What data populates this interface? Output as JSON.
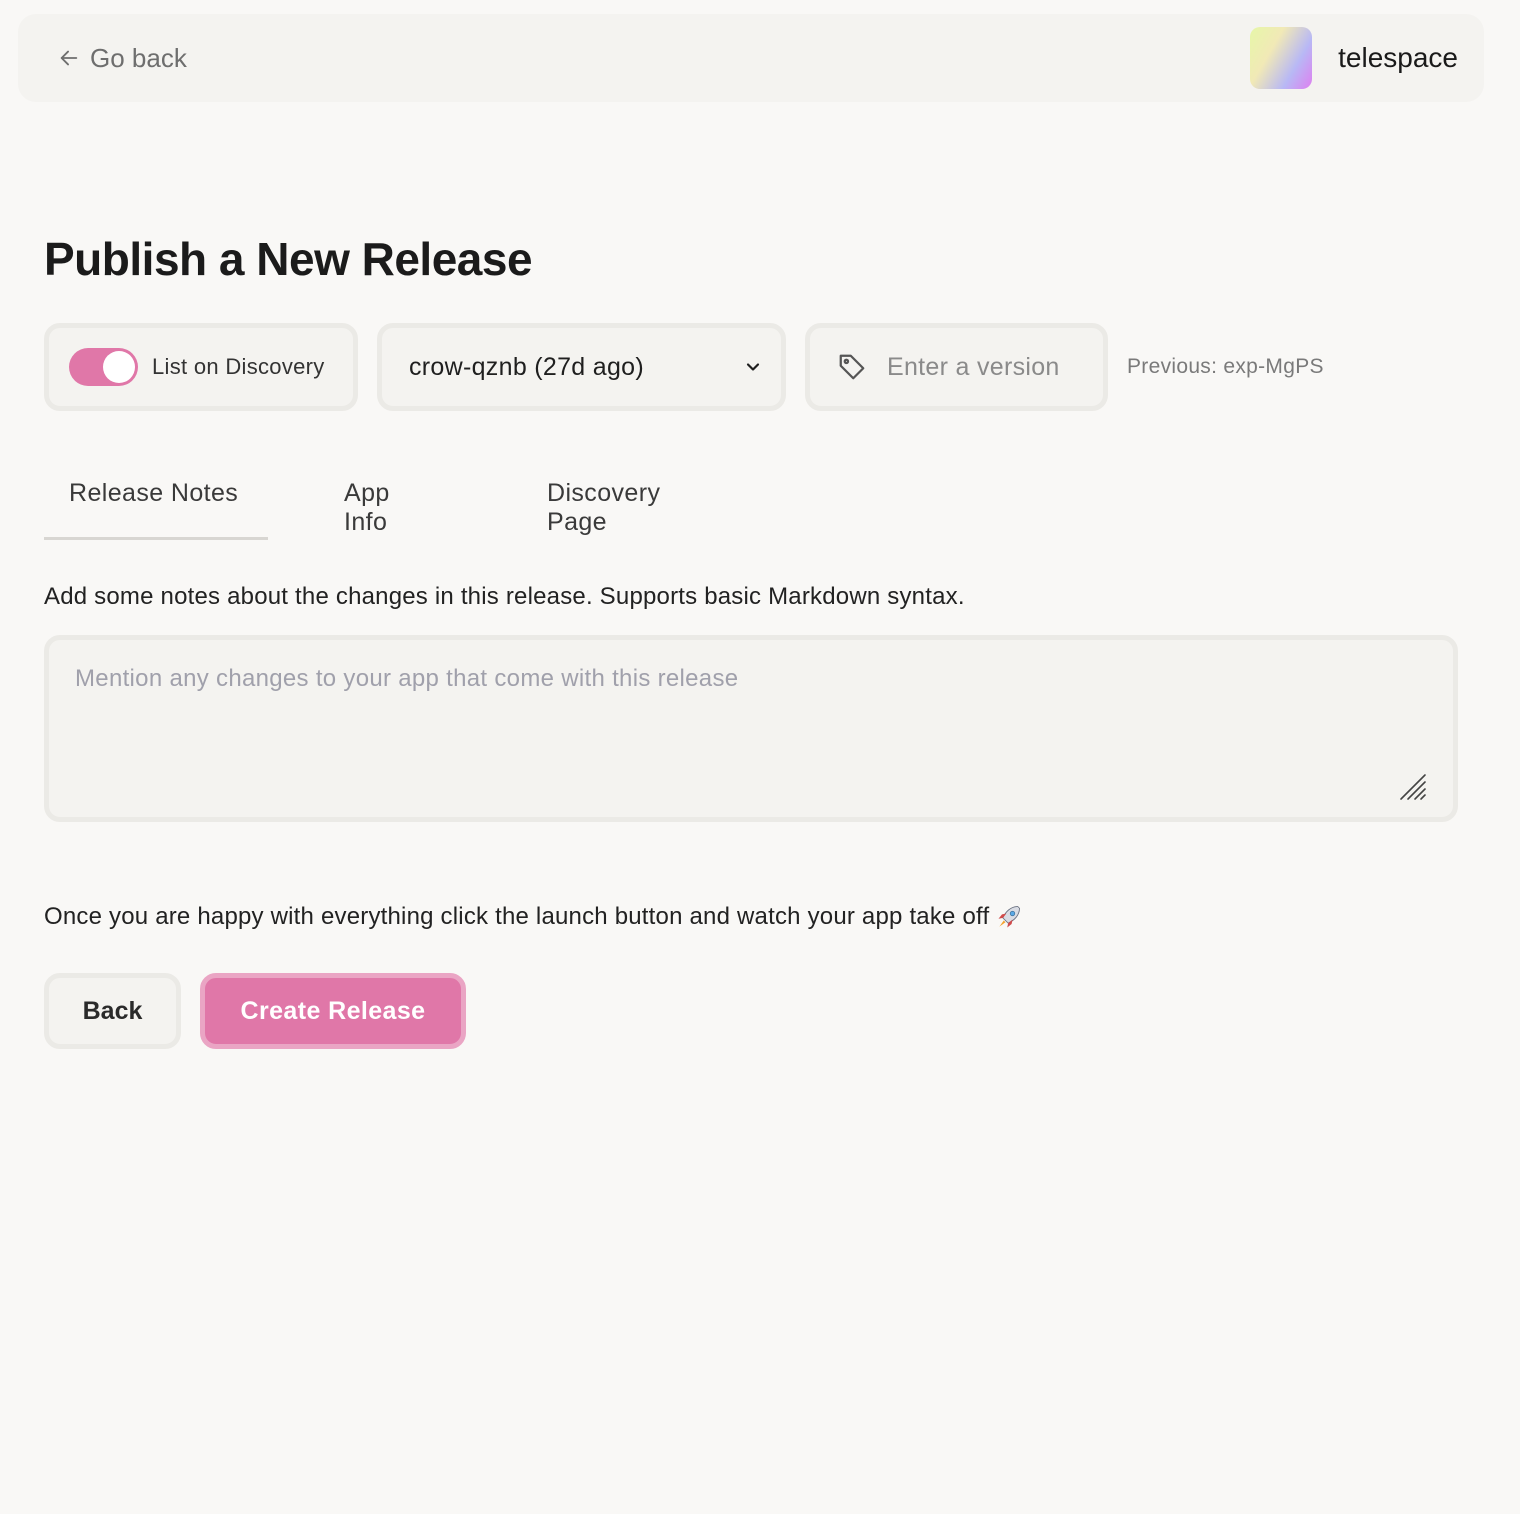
{
  "header": {
    "go_back_label": "Go back",
    "workspace_name": "telespace"
  },
  "page": {
    "title": "Publish a New Release"
  },
  "controls": {
    "list_on_discovery_label": "List on Discovery",
    "list_on_discovery_enabled": true,
    "build_select_value": "crow-qznb (27d ago)",
    "version_placeholder": "Enter a version",
    "version_value": "",
    "previous_version": "Previous: exp-MgPS"
  },
  "tabs": [
    {
      "label": "Release Notes",
      "active": true
    },
    {
      "label": "App Info",
      "active": false
    },
    {
      "label": "Discovery Page",
      "active": false
    }
  ],
  "release_notes": {
    "description": "Add some notes about the changes in this release. Supports basic Markdown syntax.",
    "placeholder": "Mention any changes to your app that come with this release",
    "value": ""
  },
  "footer": {
    "launch_text": "Once you are happy with everything click the launch button and watch your app take off",
    "back_label": "Back",
    "create_label": "Create Release"
  },
  "icons": {
    "go_back": "arrow-left-icon",
    "dropdown": "chevron-down-icon",
    "version": "tag-icon",
    "launch": "rocket-icon",
    "resize": "resize-handle-icon"
  },
  "colors": {
    "accent": "#e077a8",
    "accent_border": "#eaa5c4",
    "background": "#f9f8f6",
    "panel": "#f4f3f0"
  }
}
